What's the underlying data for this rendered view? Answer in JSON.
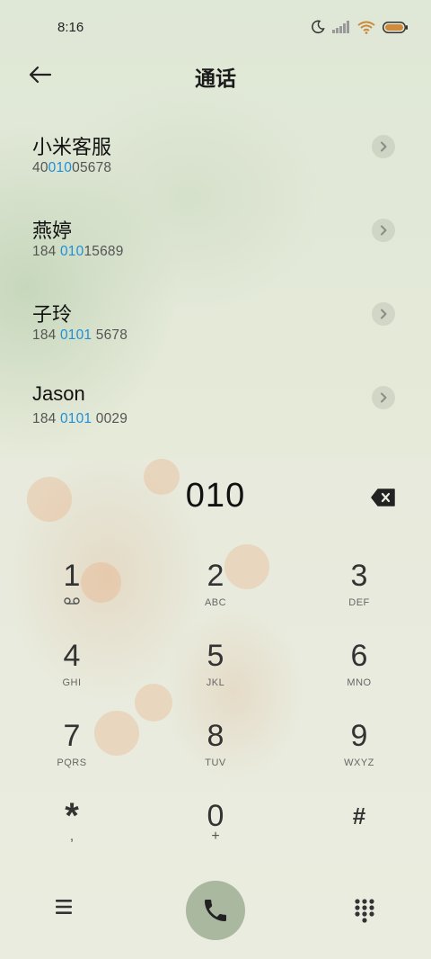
{
  "status_bar": {
    "time": "8:16",
    "icons": [
      "moon-icon",
      "signal-icon",
      "wifi-icon",
      "battery-icon"
    ]
  },
  "header": {
    "title": "通话",
    "back_icon": "arrow-left-icon"
  },
  "contacts": [
    {
      "name": "小米客服",
      "number_parts": [
        "40",
        "010",
        "05678"
      ]
    },
    {
      "name": "燕婷",
      "number_parts": [
        "184 ",
        "010",
        "15689"
      ]
    },
    {
      "name": "子玲",
      "number_parts": [
        "184 ",
        "0101",
        " 5678"
      ]
    },
    {
      "name": "Jason",
      "number_parts": [
        "184 ",
        "0101",
        " 0029"
      ]
    }
  ],
  "dialer": {
    "display": "010",
    "keys": [
      {
        "digit": "1",
        "letters": ""
      },
      {
        "digit": "2",
        "letters": "ABC"
      },
      {
        "digit": "3",
        "letters": "DEF"
      },
      {
        "digit": "4",
        "letters": "GHI"
      },
      {
        "digit": "5",
        "letters": "JKL"
      },
      {
        "digit": "6",
        "letters": "MNO"
      },
      {
        "digit": "7",
        "letters": "PQRS"
      },
      {
        "digit": "8",
        "letters": "TUV"
      },
      {
        "digit": "9",
        "letters": "WXYZ"
      },
      {
        "digit": "*",
        "letters": ","
      },
      {
        "digit": "0",
        "letters": "+"
      },
      {
        "digit": "#",
        "letters": ""
      }
    ]
  },
  "colors": {
    "highlight": "#1f8fd8",
    "call_button": "#a9b89f",
    "background": "#e9ecde"
  }
}
